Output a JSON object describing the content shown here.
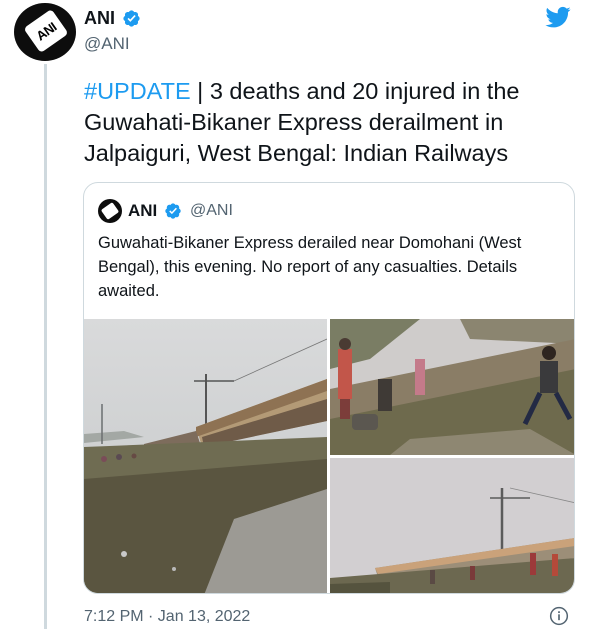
{
  "tweet": {
    "author_name": "ANI",
    "author_handle": "@ANI",
    "avatar_text": "ANI",
    "hashtag": "#UPDATE",
    "text": " | 3 deaths and 20 injured in the Guwahati-Bikaner Express derailment in Jalpaiguri, West Bengal: Indian Railways",
    "timestamp": "7:12 PM · Jan 13, 2022"
  },
  "quoted": {
    "author_name": "ANI",
    "author_handle": "@ANI",
    "text": "Guwahati-Bikaner Express derailed near Domohani (West Bengal), this evening. No report of any casualties. Details awaited."
  },
  "colors": {
    "accent": "#1d9bf0",
    "text": "#0f1419",
    "muted": "#536471",
    "border": "#cfd9de"
  },
  "icons": [
    "verified-badge-icon",
    "twitter-bird-icon",
    "info-icon"
  ]
}
